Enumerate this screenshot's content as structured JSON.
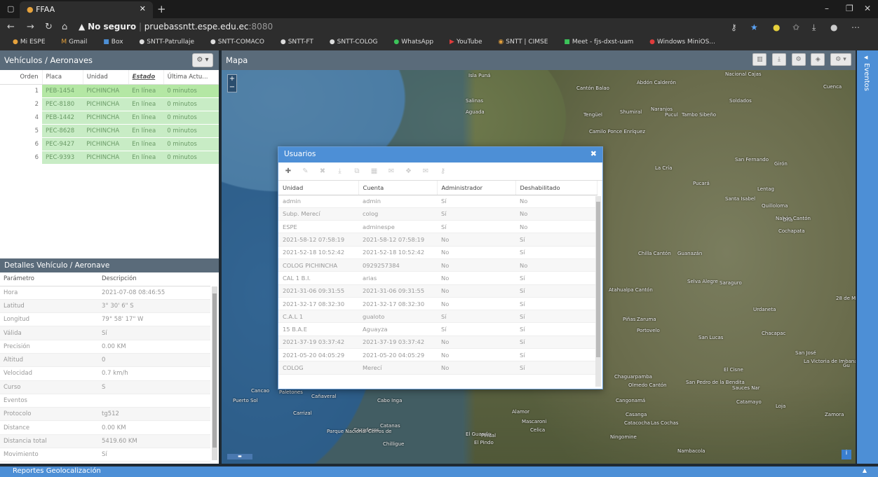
{
  "browser": {
    "tab_title": "FFAA",
    "url_warning": "No seguro",
    "url_host": "pruebassntt.espe.edu.ec",
    "url_port": ":8080",
    "bookmarks": [
      "Mi ESPE",
      "Gmail",
      "Box",
      "SNTT-Patrullaje",
      "SNTT-COMACO",
      "SNTT-FT",
      "SNTT-COLOG",
      "WhatsApp",
      "YouTube",
      "SNTT | CIMSE",
      "Meet - fjs-dxst-uam",
      "Windows MiniOS..."
    ]
  },
  "vehicles": {
    "title": "Vehículos / Aeronaves",
    "columns": [
      "Orden",
      "Placa",
      "Unidad",
      "Estado",
      "Última Actu..."
    ],
    "rows": [
      {
        "orden": "1",
        "placa": "PEB-1454",
        "unidad": "PICHINCHA",
        "estado": "En línea",
        "ultima": "0 minutos"
      },
      {
        "orden": "2",
        "placa": "PEC-8180",
        "unidad": "PICHINCHA",
        "estado": "En línea",
        "ultima": "0 minutos"
      },
      {
        "orden": "4",
        "placa": "PEB-1442",
        "unidad": "PICHINCHA",
        "estado": "En línea",
        "ultima": "0 minutos"
      },
      {
        "orden": "5",
        "placa": "PEC-8628",
        "unidad": "PICHINCHA",
        "estado": "En línea",
        "ultima": "0 minutos"
      },
      {
        "orden": "6",
        "placa": "PEC-9427",
        "unidad": "PICHINCHA",
        "estado": "En línea",
        "ultima": "0 minutos"
      },
      {
        "orden": "6",
        "placa": "PEC-9393",
        "unidad": "PICHINCHA",
        "estado": "En línea",
        "ultima": "0 minutos"
      }
    ]
  },
  "details": {
    "title": "Detalles Vehículo / Aeronave",
    "columns": [
      "Parámetro",
      "Descripción"
    ],
    "rows": [
      {
        "param": "Hora",
        "desc": "2021-07-08 08:46:55"
      },
      {
        "param": "Latitud",
        "desc": "3° 30' 6\" S"
      },
      {
        "param": "Longitud",
        "desc": "79° 58' 17\" W"
      },
      {
        "param": "Válida",
        "desc": "Sí"
      },
      {
        "param": "Precisión",
        "desc": "0.00 KM"
      },
      {
        "param": "Altitud",
        "desc": "0"
      },
      {
        "param": "Velocidad",
        "desc": "0.7 km/h"
      },
      {
        "param": "Curso",
        "desc": "S"
      },
      {
        "param": "Eventos",
        "desc": ""
      },
      {
        "param": "Protocolo",
        "desc": "tg512"
      },
      {
        "param": "Distance",
        "desc": "0.00 KM"
      },
      {
        "param": "Distancia total",
        "desc": "5419.60 KM"
      },
      {
        "param": "Movimiento",
        "desc": "Sí"
      }
    ]
  },
  "map": {
    "title": "Mapa",
    "places": [
      "Isla Puná",
      "Cantón Balao",
      "Abdón Calderón",
      "Nacional Cajas",
      "Cuenca",
      "Salinas",
      "Aguada",
      "Tengüel",
      "Shumiral",
      "Naranjos",
      "Pucul",
      "Tambo Sibeño",
      "Soldados",
      "Camilo Ponce Enríquez",
      "La Cría",
      "San Fernando",
      "Girón",
      "Pucará",
      "Santa Isabel",
      "Lentag",
      "Quilloloma",
      "Nabón Cantón",
      "Oña",
      "Cochapata",
      "Chilla Cantón",
      "Guanazán",
      "Atahualpa Cantón",
      "Selva Alegre",
      "Saraguro",
      "Urdaneta",
      "Chacapac",
      "Piñas",
      "Zaruma",
      "Portovelo",
      "San Lucas",
      "San José",
      "La Victoria de Imbana",
      "El Cisne",
      "Chaguarpamba",
      "Olmedo Cantón",
      "San Pedro de la Bendita",
      "Sauces Nar",
      "Cangonamá",
      "Catamayo",
      "Loja",
      "Casanga",
      "Catacocha",
      "Las Cochas",
      "Zamora",
      "Ningomine",
      "Nambacola",
      "Cancao",
      "Paletones",
      "Cañaveral",
      "Cabo Inga",
      "Carrizal",
      "Puerto Sol",
      "Cazaderos",
      "Catanas",
      "Alamor",
      "Mascaroni",
      "Celica",
      "El Guando",
      "Pindal",
      "El Pindo",
      "Parque Nacional Cerros de",
      "Chilligue",
      "28 de M",
      "Gu"
    ]
  },
  "events_label": "Eventos",
  "footer_label": "Reportes Geolocalización",
  "users": {
    "title": "Usuarios",
    "columns": [
      "Unidad",
      "Cuenta",
      "Administrador",
      "Deshabilitado"
    ],
    "rows": [
      {
        "unidad": "admin",
        "cuenta": "admin",
        "admin": "Sí",
        "desh": "No"
      },
      {
        "unidad": "Subp. Merecí",
        "cuenta": "colog",
        "admin": "Sí",
        "desh": "No"
      },
      {
        "unidad": "ESPE",
        "cuenta": "adminespe",
        "admin": "Sí",
        "desh": "No"
      },
      {
        "unidad": "2021-58-12 07:58:19",
        "cuenta": "2021-58-12 07:58:19",
        "admin": "No",
        "desh": "Sí"
      },
      {
        "unidad": "2021-52-18 10:52:42",
        "cuenta": "2021-52-18 10:52:42",
        "admin": "No",
        "desh": "Sí"
      },
      {
        "unidad": "COLOG PICHINCHA",
        "cuenta": "0929257384",
        "admin": "No",
        "desh": "No"
      },
      {
        "unidad": "CAL 1 B.I.",
        "cuenta": "arias",
        "admin": "No",
        "desh": "Sí"
      },
      {
        "unidad": "2021-31-06 09:31:55",
        "cuenta": "2021-31-06 09:31:55",
        "admin": "No",
        "desh": "Sí"
      },
      {
        "unidad": "2021-32-17 08:32:30",
        "cuenta": "2021-32-17 08:32:30",
        "admin": "No",
        "desh": "Sí"
      },
      {
        "unidad": "C.A.L 1",
        "cuenta": "gualoto",
        "admin": "Sí",
        "desh": "Sí"
      },
      {
        "unidad": "15 B.A.E",
        "cuenta": "Aguayza",
        "admin": "Sí",
        "desh": "Sí"
      },
      {
        "unidad": "2021-37-19 03:37:42",
        "cuenta": "2021-37-19 03:37:42",
        "admin": "No",
        "desh": "Sí"
      },
      {
        "unidad": "2021-05-20 04:05:29",
        "cuenta": "2021-05-20 04:05:29",
        "admin": "No",
        "desh": "Sí"
      },
      {
        "unidad": "COLOG",
        "cuenta": "Merecí",
        "admin": "No",
        "desh": "Sí"
      }
    ]
  }
}
